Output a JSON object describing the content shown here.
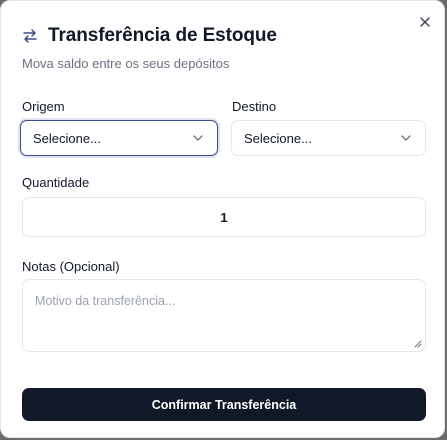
{
  "dialog": {
    "title": "Transferência de Estoque",
    "title_icon": "arrow-left-right-icon",
    "subtitle": "Mova saldo entre os seus depósitos",
    "close_icon": "close-icon"
  },
  "form": {
    "origin": {
      "label": "Origem",
      "value": "Selecione..."
    },
    "destination": {
      "label": "Destino",
      "value": "Selecione..."
    },
    "quantity": {
      "label": "Quantidade",
      "value": "1"
    },
    "notes": {
      "label": "Notas (Opcional)",
      "placeholder": "Motivo da transferência..."
    }
  },
  "actions": {
    "confirm_label": "Confirmar Transferência"
  },
  "colors": {
    "primary": "#111827",
    "focus_ring": "#3b4b8c",
    "muted_text": "#6b7280",
    "border": "#e5e7eb"
  }
}
